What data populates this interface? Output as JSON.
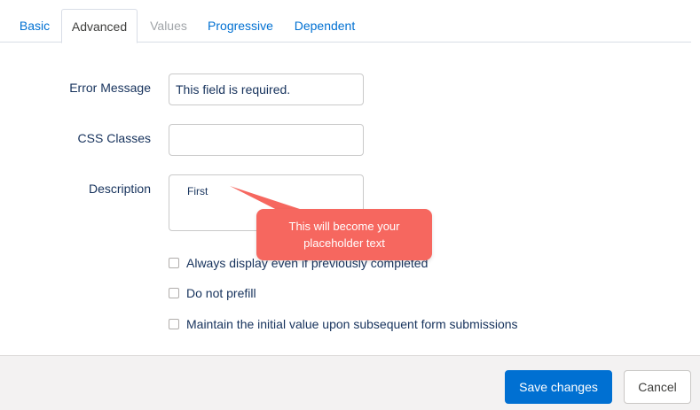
{
  "tabs": [
    {
      "label": "Basic",
      "state": "link"
    },
    {
      "label": "Advanced",
      "state": "active"
    },
    {
      "label": "Values",
      "state": "disabled"
    },
    {
      "label": "Progressive",
      "state": "link"
    },
    {
      "label": "Dependent",
      "state": "link"
    }
  ],
  "form": {
    "error_message": {
      "label": "Error Message",
      "value": "This field is required."
    },
    "css_classes": {
      "label": "CSS Classes",
      "value": ""
    },
    "description": {
      "label": "Description",
      "value": "First"
    }
  },
  "checkboxes": [
    {
      "label": "Always display even if previously completed",
      "checked": false
    },
    {
      "label": "Do not prefill",
      "checked": false
    },
    {
      "label": "Maintain the initial value upon subsequent form submissions",
      "checked": false
    }
  ],
  "callout": {
    "line1": "This will become your",
    "line2": "placeholder text",
    "color": "#f6675f"
  },
  "footer": {
    "save_label": "Save changes",
    "cancel_label": "Cancel"
  },
  "colors": {
    "accent": "#0070d2",
    "footer_bg": "#f3f2f2"
  }
}
